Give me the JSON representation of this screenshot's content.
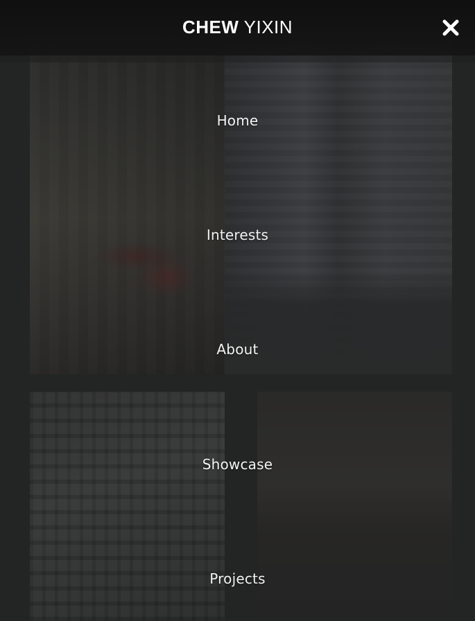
{
  "header": {
    "brand_first": "CHEW",
    "brand_last": "YIXIN",
    "close_icon": "close-icon"
  },
  "nav": {
    "items": [
      {
        "label": "Home"
      },
      {
        "label": "Interests"
      },
      {
        "label": "About"
      },
      {
        "label": "Showcase"
      },
      {
        "label": "Projects"
      }
    ]
  },
  "colors": {
    "overlay": "#1e2020",
    "text": "#f3f3f3",
    "header": "#101010"
  }
}
